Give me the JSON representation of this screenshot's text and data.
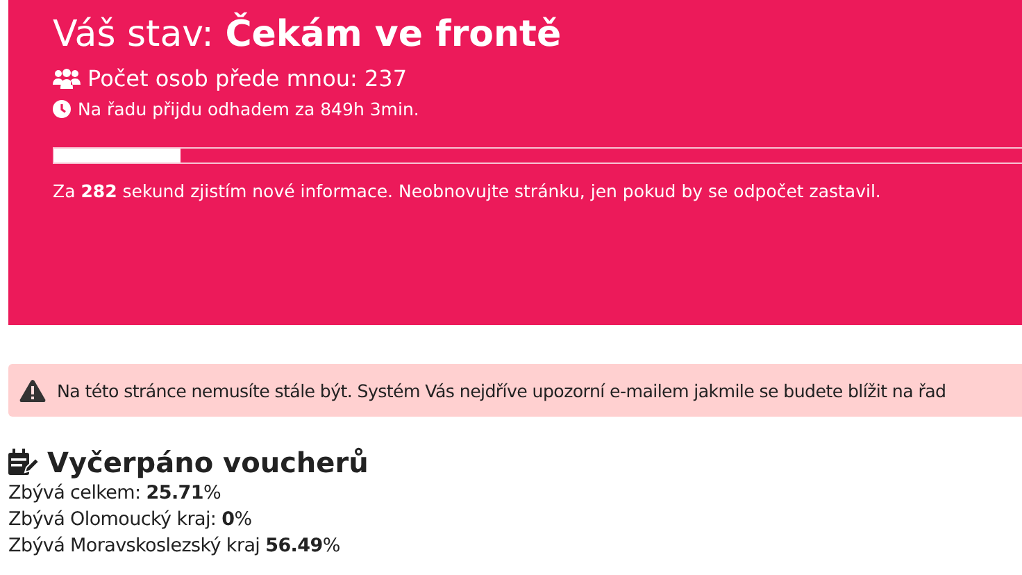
{
  "status": {
    "title": "Váš stav: **Čekám ve frontě**",
    "people_ahead": "Počet osob přede mnou: 237",
    "estimate": "Na řadu přijdu odhadem za 849h 3min.",
    "progress": {
      "level": 0.13
    },
    "refresh_note": "Za **282** sekund zjistím nové informace. Neobnovujte stránku, jen pokud by se odpočet zastavil."
  },
  "alert": {
    "text": "Na této stránce nemusíte stále být. Systém Vás nejdříve upozorní e-mailem jakmile se budete blížit na řad"
  },
  "vouchers": {
    "heading": "Vyčerpáno voucherů",
    "rows": [
      "Zbývá celkem: **25.71**%",
      "Zbývá Olomoucký kraj: **0**%",
      "Zbývá Moravskoslezský kraj **56.49**%"
    ]
  }
}
